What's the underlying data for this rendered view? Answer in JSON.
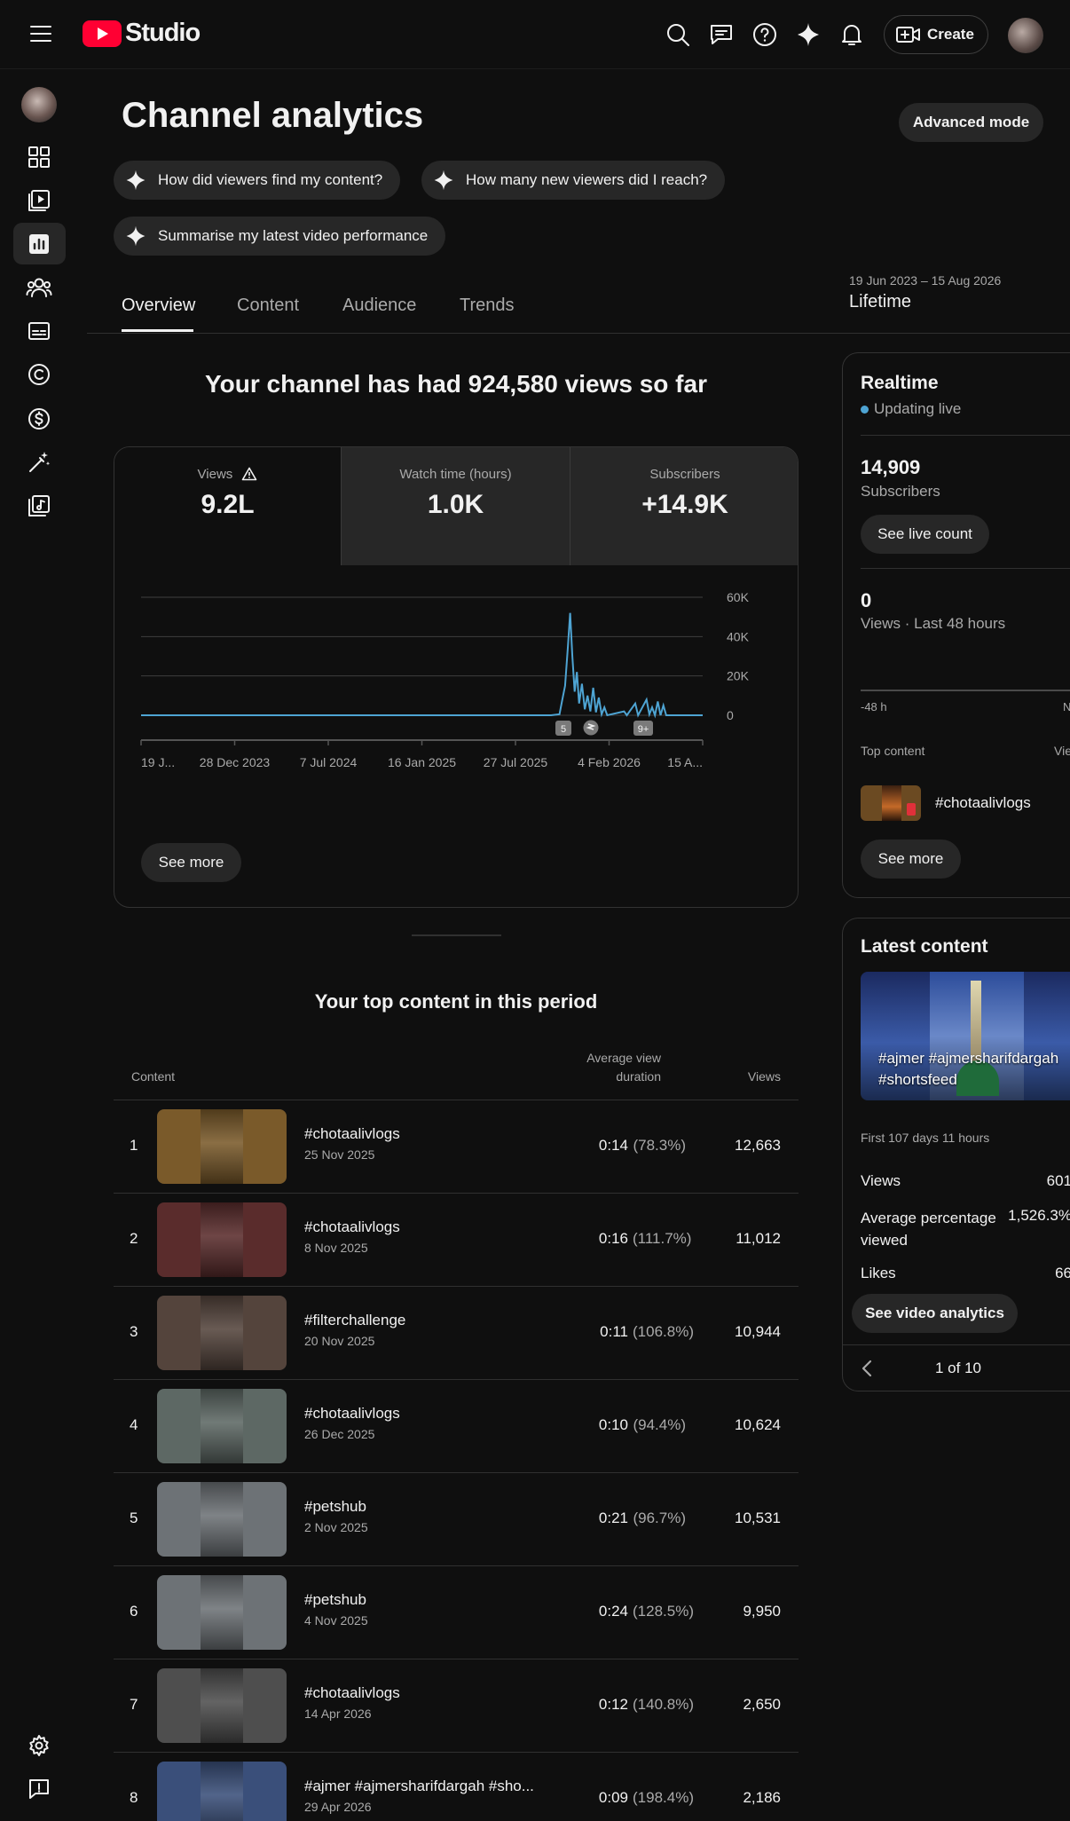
{
  "app": {
    "name": "Studio"
  },
  "header": {
    "create_label": "Create"
  },
  "page": {
    "title": "Channel analytics",
    "advanced_mode": "Advanced mode"
  },
  "suggestions": [
    "How did viewers find my content?",
    "How many new viewers did I reach?",
    "Summarise my latest video performance"
  ],
  "tabs": [
    "Overview",
    "Content",
    "Audience",
    "Trends"
  ],
  "date_range": {
    "range": "19 Jun 2023 – 15 Aug 2026",
    "label": "Lifetime"
  },
  "overview": {
    "headline": "Your channel has had 924,580 views so far",
    "metrics": [
      {
        "label": "Views",
        "value": "9.2L"
      },
      {
        "label": "Watch time (hours)",
        "value": "1.0K"
      },
      {
        "label": "Subscribers",
        "value": "+14.9K"
      }
    ],
    "see_more": "See more"
  },
  "chart_data": {
    "type": "line",
    "x_ticks": [
      "19 J...",
      "28 Dec 2023",
      "7 Jul 2024",
      "16 Jan 2025",
      "27 Jul 2025",
      "4 Feb 2026",
      "15 A..."
    ],
    "y_ticks": [
      "60K",
      "40K",
      "20K",
      "0"
    ],
    "ylim": [
      0,
      60000
    ],
    "grid": true,
    "series": [
      {
        "values_approx": [
          [
            0.0,
            0
          ],
          [
            0.73,
            0
          ],
          [
            0.745,
            500
          ],
          [
            0.75,
            8000
          ],
          [
            0.755,
            15000
          ],
          [
            0.76,
            35000
          ],
          [
            0.764,
            52000
          ],
          [
            0.768,
            30000
          ],
          [
            0.772,
            12000
          ],
          [
            0.776,
            22000
          ],
          [
            0.78,
            6000
          ],
          [
            0.785,
            16000
          ],
          [
            0.79,
            3000
          ],
          [
            0.795,
            10000
          ],
          [
            0.8,
            2000
          ],
          [
            0.805,
            14000
          ],
          [
            0.81,
            1500
          ],
          [
            0.815,
            9000
          ],
          [
            0.82,
            500
          ],
          [
            0.825,
            4000
          ],
          [
            0.83,
            0
          ],
          [
            0.86,
            2000
          ],
          [
            0.865,
            0
          ],
          [
            0.88,
            6000
          ],
          [
            0.885,
            0
          ],
          [
            0.9,
            8000
          ],
          [
            0.905,
            500
          ],
          [
            0.91,
            4000
          ],
          [
            0.915,
            0
          ],
          [
            0.92,
            7000
          ],
          [
            0.925,
            0
          ],
          [
            0.93,
            5000
          ],
          [
            0.935,
            0
          ],
          [
            1.0,
            0
          ]
        ]
      }
    ],
    "markers": [
      "5",
      "9+"
    ],
    "colors": {
      "line": "#4ea4d3",
      "axis": "#3f3f3f"
    }
  },
  "realtime": {
    "title": "Realtime",
    "status": "Updating live",
    "subs_value": "14,909",
    "subs_label": "Subscribers",
    "see_live": "See live count",
    "views_value": "0",
    "views_label": "Views · Last 48 hours",
    "axis_left": "-48 h",
    "axis_right": "N",
    "top_content": "Top content",
    "views_col": "Vie",
    "top_item": "#chotaalivlogs",
    "see_more": "See more"
  },
  "latest": {
    "title": "Latest content",
    "thumb_text": "#ajmer #ajmersharifdargah #shortsfeed",
    "period": "First 107 days 11 hours",
    "stats": [
      {
        "label": "Views",
        "value": "601"
      },
      {
        "label": "Average percentage viewed",
        "value": "1,526.3%"
      },
      {
        "label": "Likes",
        "value": "66"
      }
    ],
    "see_analytics": "See video analytics",
    "pager": "1 of 10"
  },
  "top_content": {
    "title": "Your top content in this period",
    "col_content": "Content",
    "col_duration": "Average view duration",
    "col_views": "Views",
    "rows": [
      {
        "rank": "1",
        "title": "#chotaalivlogs",
        "date": "25 Nov 2025",
        "duration": "0:14",
        "pct": "(78.3%)",
        "views": "12,663",
        "bg": "#7a5a2a"
      },
      {
        "rank": "2",
        "title": "#chotaalivlogs",
        "date": "8 Nov 2025",
        "duration": "0:16",
        "pct": "(111.7%)",
        "views": "11,012",
        "bg": "#5a2c2c"
      },
      {
        "rank": "3",
        "title": "#filterchallenge",
        "date": "20 Nov 2025",
        "duration": "0:11",
        "pct": "(106.8%)",
        "views": "10,944",
        "bg": "#54443c"
      },
      {
        "rank": "4",
        "title": "#chotaalivlogs",
        "date": "26 Dec 2025",
        "duration": "0:10",
        "pct": "(94.4%)",
        "views": "10,624",
        "bg": "#5d6864"
      },
      {
        "rank": "5",
        "title": "#petshub",
        "date": "2 Nov 2025",
        "duration": "0:21",
        "pct": "(96.7%)",
        "views": "10,531",
        "bg": "#6d7276"
      },
      {
        "rank": "6",
        "title": "#petshub",
        "date": "4 Nov 2025",
        "duration": "0:24",
        "pct": "(128.5%)",
        "views": "9,950",
        "bg": "#6d7276"
      },
      {
        "rank": "7",
        "title": "#chotaalivlogs",
        "date": "14 Apr 2026",
        "duration": "0:12",
        "pct": "(140.8%)",
        "views": "2,650",
        "bg": "#4e4e4e"
      },
      {
        "rank": "8",
        "title": "#ajmer #ajmersharifdargah #sho...",
        "date": "29 Apr 2026",
        "duration": "0:09",
        "pct": "(198.4%)",
        "views": "2,186",
        "bg": "#3a4f7a"
      }
    ]
  }
}
